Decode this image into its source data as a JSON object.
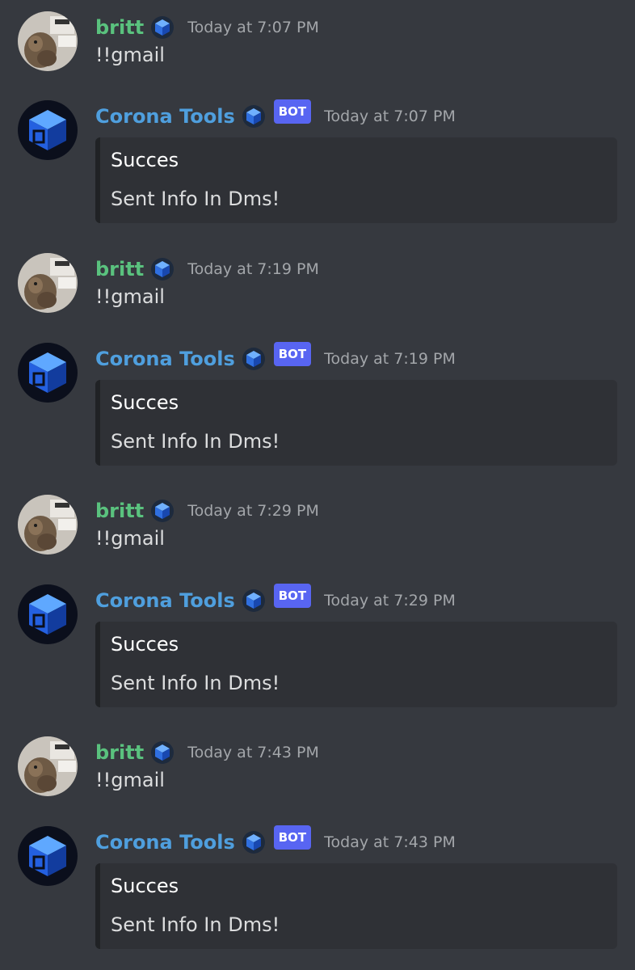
{
  "messages": [
    {
      "kind": "user",
      "username": "britt",
      "badge_icon": "blue-cube-badge-icon",
      "timestamp": "Today at 7:07 PM",
      "content": "!!gmail"
    },
    {
      "kind": "bot",
      "username": "Corona Tools",
      "badge_icon": "blue-cube-badge-icon",
      "bot_tag": "BOT",
      "timestamp": "Today at 7:07 PM",
      "embed": {
        "title": "Succes",
        "description": "Sent Info In Dms!"
      }
    },
    {
      "kind": "user",
      "username": "britt",
      "badge_icon": "blue-cube-badge-icon",
      "timestamp": "Today at 7:19 PM",
      "content": "!!gmail"
    },
    {
      "kind": "bot",
      "username": "Corona Tools",
      "badge_icon": "blue-cube-badge-icon",
      "bot_tag": "BOT",
      "timestamp": "Today at 7:19 PM",
      "embed": {
        "title": "Succes",
        "description": "Sent Info In Dms!"
      }
    },
    {
      "kind": "user",
      "username": "britt",
      "badge_icon": "blue-cube-badge-icon",
      "timestamp": "Today at 7:29 PM",
      "content": "!!gmail"
    },
    {
      "kind": "bot",
      "username": "Corona Tools",
      "badge_icon": "blue-cube-badge-icon",
      "bot_tag": "BOT",
      "timestamp": "Today at 7:29 PM",
      "embed": {
        "title": "Succes",
        "description": "Sent Info In Dms!"
      }
    },
    {
      "kind": "user",
      "username": "britt",
      "badge_icon": "blue-cube-badge-icon",
      "timestamp": "Today at 7:43 PM",
      "content": "!!gmail"
    },
    {
      "kind": "bot",
      "username": "Corona Tools",
      "badge_icon": "blue-cube-badge-icon",
      "bot_tag": "BOT",
      "timestamp": "Today at 7:43 PM",
      "embed": {
        "title": "Succes",
        "description": "Sent Info In Dms!"
      }
    }
  ],
  "colors": {
    "background": "#36393f",
    "user_name": "#5ac27e",
    "bot_name": "#4f9fde",
    "bot_tag": "#5865f2",
    "embed_background": "#2f3136",
    "timestamp": "#a3a6aa"
  }
}
